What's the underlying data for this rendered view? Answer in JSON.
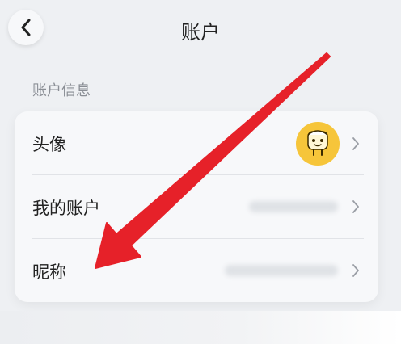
{
  "header": {
    "title": "账户"
  },
  "section": {
    "label": "账户信息"
  },
  "rows": [
    {
      "label": "头像"
    },
    {
      "label": "我的账户"
    },
    {
      "label": "昵称"
    }
  ],
  "icons": {
    "back": "chevron-left-icon",
    "row_chevron": "chevron-right-icon",
    "avatar": "avatar-cartoon-icon",
    "annotation": "red-arrow"
  },
  "colors": {
    "background": "#eef0f3",
    "card": "#f7f8fa",
    "avatar_bg": "#f6c53a",
    "arrow": "#e62129"
  }
}
